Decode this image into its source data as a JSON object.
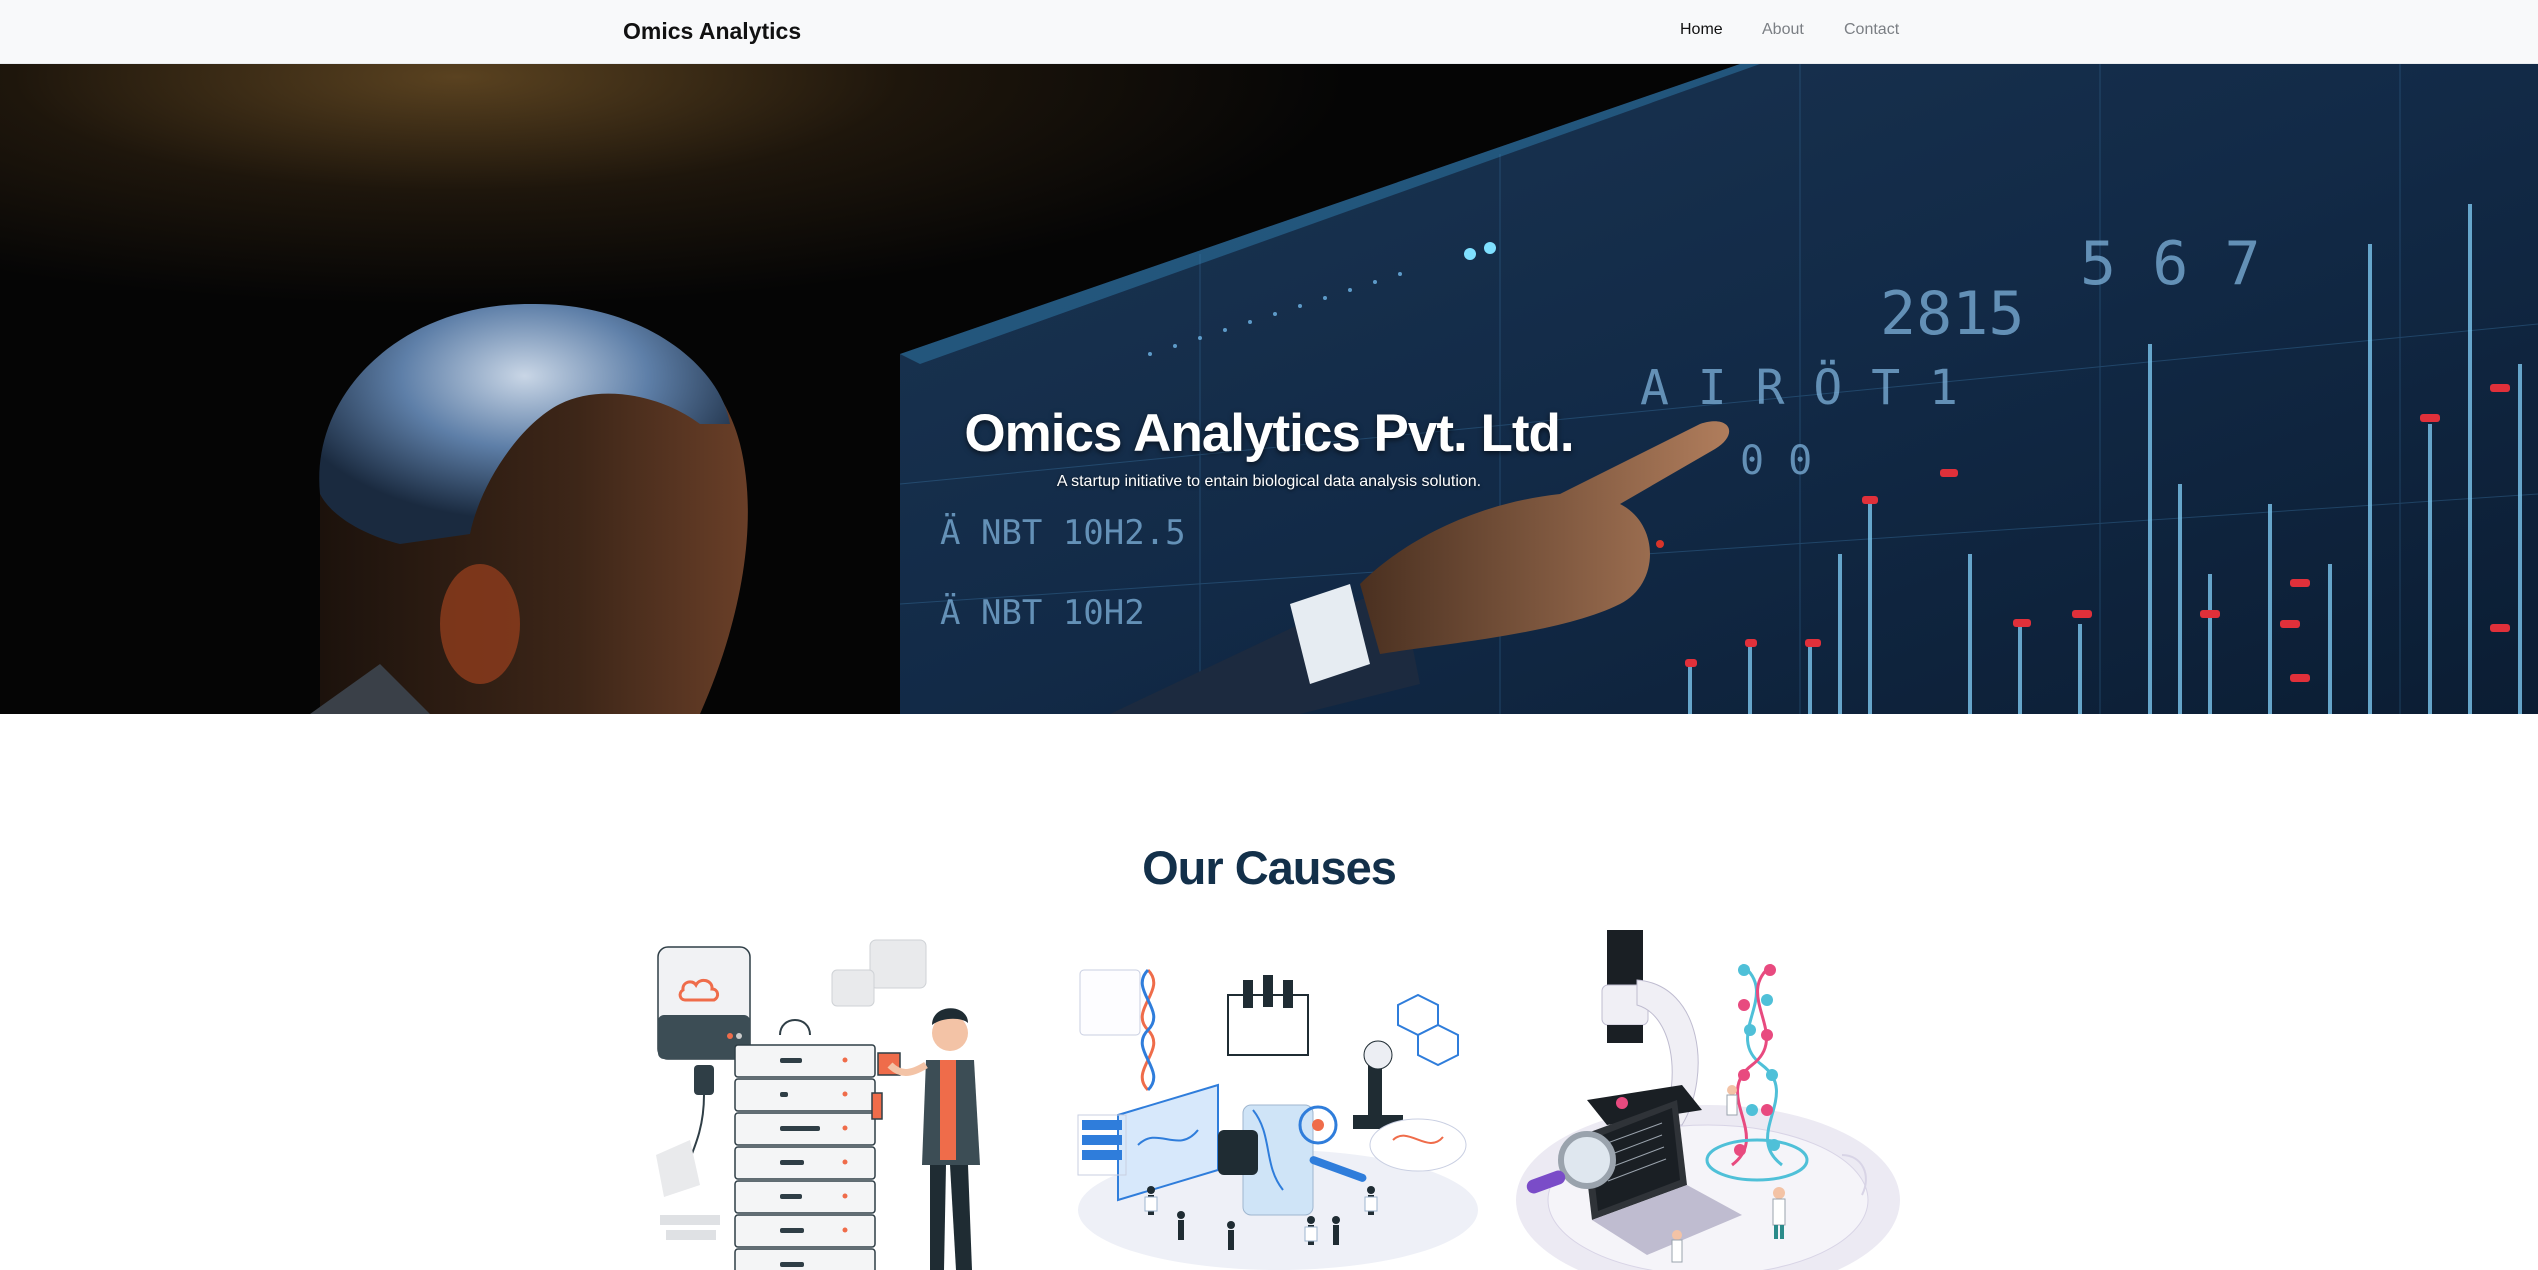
{
  "navbar": {
    "brand": "Omics Analytics",
    "links": [
      {
        "label": "Home",
        "active": true
      },
      {
        "label": "About",
        "active": false
      },
      {
        "label": "Contact",
        "active": false
      }
    ]
  },
  "hero": {
    "title": "Omics Analytics Pvt. Ltd.",
    "subtitle": "A startup initiative to entain biological data analysis solution."
  },
  "causes": {
    "title": "Our Causes",
    "illustrations": [
      {
        "icon": "cloud-server-illustration"
      },
      {
        "icon": "laboratory-research-illustration"
      },
      {
        "icon": "microscope-dna-illustration"
      }
    ]
  },
  "colors": {
    "navbar_bg": "#f8f9fa",
    "brand_text": "#111111",
    "causes_title": "#13304a",
    "accent_orange": "#ef6c4a",
    "accent_blue": "#2f7ddb",
    "accent_pink": "#e84a7f"
  }
}
